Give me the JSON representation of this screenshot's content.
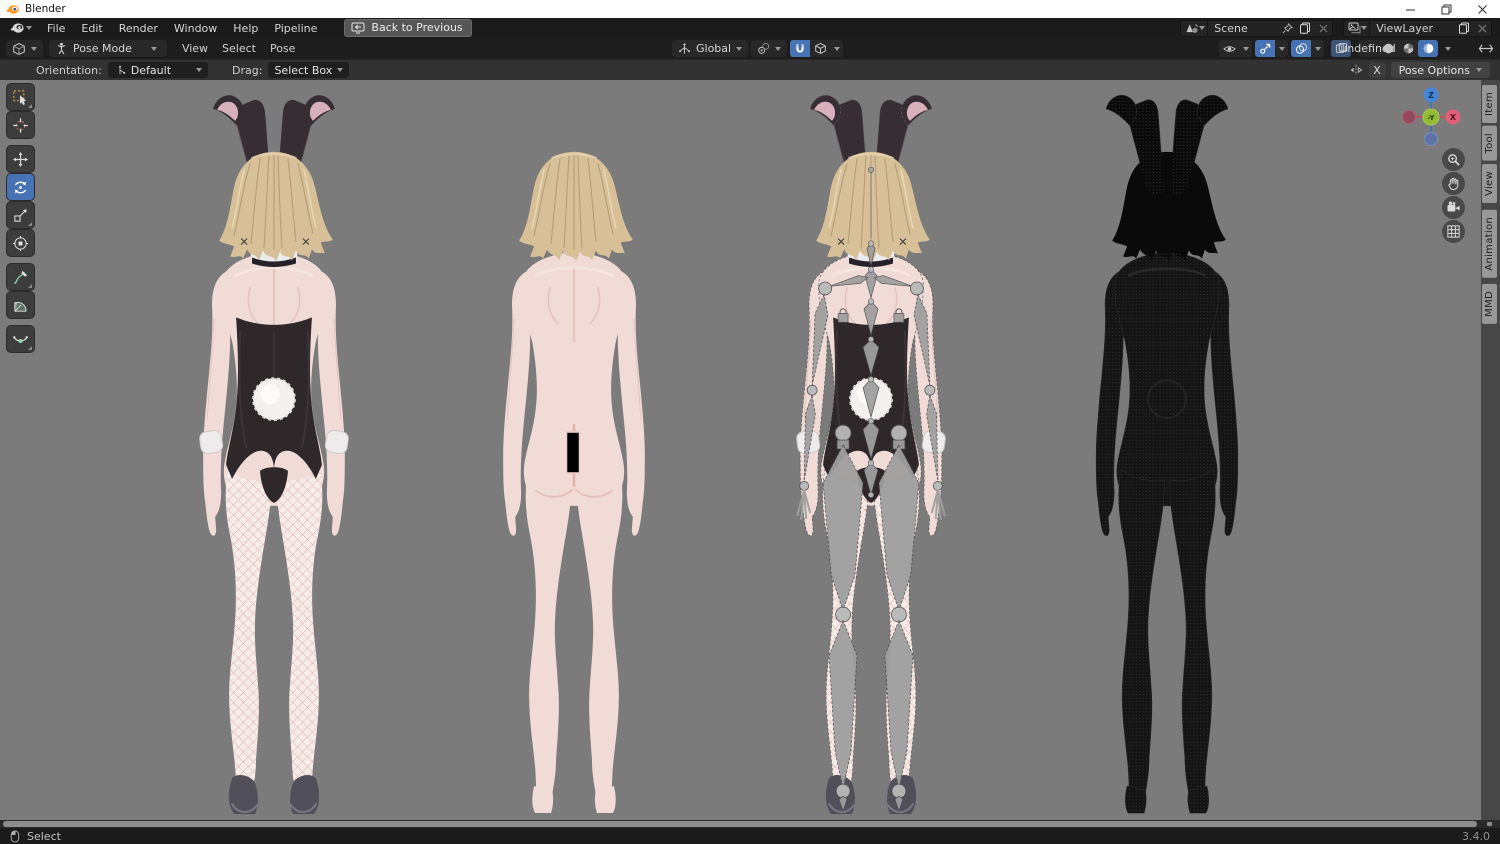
{
  "window": {
    "title": "Blender"
  },
  "menubar": {
    "items": [
      "File",
      "Edit",
      "Render",
      "Window",
      "Help",
      "Pipeline"
    ],
    "back_to_previous": "Back to Previous",
    "scene_selector": {
      "value": "Scene"
    },
    "view_layer_selector": {
      "value": "ViewLayer"
    }
  },
  "header": {
    "mode_selector": "Pose Mode",
    "menus": [
      "View",
      "Select",
      "Pose"
    ],
    "transform_orientation": "Global"
  },
  "tool_settings": {
    "orientation_label": "Orientation:",
    "orientation_value": "Default",
    "drag_label": "Drag:",
    "drag_value": "Select Box",
    "mirror_x_label": "X",
    "pose_options_label": "Pose Options"
  },
  "toolbar_tools": [
    {
      "id": "select-box",
      "icon": "tool-select-icon",
      "active": false,
      "group": 0,
      "notch": true
    },
    {
      "id": "cursor",
      "icon": "tool-cursor-icon",
      "active": false,
      "group": 0,
      "notch": false
    },
    {
      "id": "move",
      "icon": "tool-move-icon",
      "active": false,
      "group": 1,
      "notch": false
    },
    {
      "id": "rotate",
      "icon": "tool-rotate-icon",
      "active": true,
      "group": 1,
      "notch": false
    },
    {
      "id": "scale",
      "icon": "tool-scale-icon",
      "active": false,
      "group": 1,
      "notch": true
    },
    {
      "id": "transform",
      "icon": "tool-transform-icon",
      "active": false,
      "group": 1,
      "notch": false
    },
    {
      "id": "annotate",
      "icon": "tool-annotate-icon",
      "active": false,
      "group": 2,
      "notch": true
    },
    {
      "id": "measure",
      "icon": "tool-measure-icon",
      "active": false,
      "group": 2,
      "notch": false
    },
    {
      "id": "breakdowner",
      "icon": "tool-breakdowner-icon",
      "active": false,
      "group": 3,
      "notch": true
    }
  ],
  "shading_modes": [
    {
      "id": "wireframe",
      "active": false
    },
    {
      "id": "solid",
      "active": false
    },
    {
      "id": "material-preview",
      "active": false
    },
    {
      "id": "rendered",
      "active": true
    }
  ],
  "toggles": {
    "snap": true,
    "gizmos": true,
    "overlays": true,
    "xray": true
  },
  "nav_gizmo": {
    "axis_z": "Z",
    "axis_x": "X",
    "axis_y_neg": "-Y"
  },
  "nav_buttons": [
    "zoom",
    "pan",
    "camera",
    "perspective"
  ],
  "sidebar_tabs": [
    "Item",
    "Tool",
    "View",
    "Animation",
    "MMD"
  ],
  "status_bar": {
    "hint": "Select",
    "version": "3.4.0"
  },
  "colors": {
    "accent": "#4772b3",
    "viewport_bg": "#7b7b7b",
    "skin": "#f0dbd6",
    "skin_shade": "#dcaea6",
    "skin_light": "#f8ece8",
    "hair": "#d7c098",
    "hair_dark": "#a58e69",
    "hair_light": "#ecdcba",
    "ear": "#362e33",
    "ear_edge": "#6b5b62",
    "ear_inner": "#d7b0bc",
    "leotard": "#2e282b",
    "leotard_hi": "#4a4046",
    "collar": "#ebebed",
    "cuff": "#edebec",
    "net": "#c98f92",
    "heel": "#51505a",
    "heel_hi": "#82828e",
    "tail": "#f3f1ef",
    "bone": "#9f9f9f",
    "bone_line": "#4e4e50",
    "joint": "#b9b9b9",
    "wire": "#141414",
    "wire_hair": "#0a0a0a",
    "wire_dot": "#323232",
    "censor": "#000000",
    "censor_edge": "#e9cdc6"
  },
  "figures": [
    {
      "id": "figure-bunny-textured",
      "variant": "textured"
    },
    {
      "id": "figure-body-nude",
      "variant": "nude"
    },
    {
      "id": "figure-bunny-armature",
      "variant": "armature"
    },
    {
      "id": "figure-body-wireframe",
      "variant": "wireframe"
    }
  ]
}
